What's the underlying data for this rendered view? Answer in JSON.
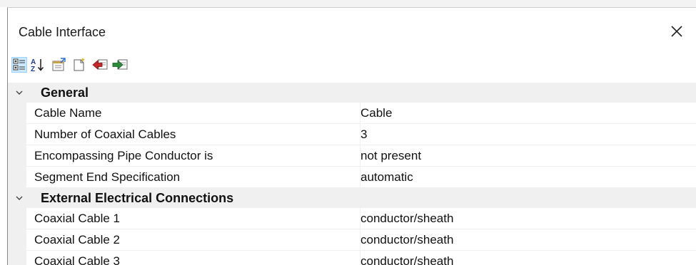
{
  "window": {
    "title": "Cable Interface"
  },
  "toolbar": {
    "buttons": [
      {
        "name": "categorized-icon",
        "active": true
      },
      {
        "name": "sort-alphabetical-icon",
        "active": false
      },
      {
        "name": "property-pages-icon",
        "active": false
      },
      {
        "name": "new-document-icon",
        "active": false
      },
      {
        "name": "import-icon",
        "active": false
      },
      {
        "name": "export-icon",
        "active": false
      }
    ]
  },
  "categories": [
    {
      "label": "General",
      "expanded": true,
      "properties": [
        {
          "name": "Cable Name",
          "value": "Cable"
        },
        {
          "name": "Number of Coaxial Cables",
          "value": "3"
        },
        {
          "name": "Encompassing Pipe Conductor is",
          "value": "not present"
        },
        {
          "name": "Segment End Specification",
          "value": "automatic"
        }
      ]
    },
    {
      "label": "External Electrical Connections",
      "expanded": true,
      "properties": [
        {
          "name": "Coaxial Cable 1",
          "value": "conductor/sheath"
        },
        {
          "name": "Coaxial Cable 2",
          "value": "conductor/sheath"
        },
        {
          "name": "Coaxial Cable 3",
          "value": "conductor/sheath"
        }
      ]
    }
  ],
  "colors": {
    "category_background": "#f0f0f0",
    "selected_button": "#cce8ff"
  }
}
